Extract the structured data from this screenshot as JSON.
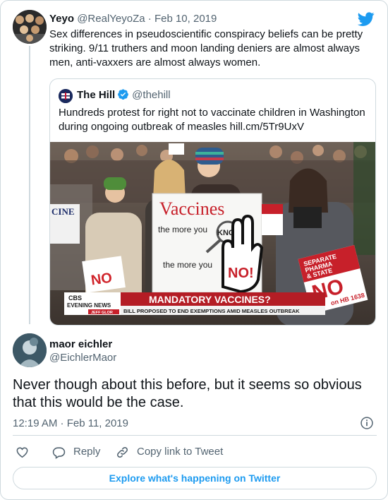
{
  "parent_tweet": {
    "author_name": "Yeyo",
    "author_handle": "@RealYeyoZa",
    "separator": " · ",
    "date": "Feb 10, 2019",
    "text": "Sex differences in pseudoscientific conspiracy beliefs can be pretty striking. 9/11 truthers and moon landing deniers are almost always men, anti-vaxxers are almost always women."
  },
  "quoted_tweet": {
    "author_name": "The Hill",
    "author_handle": "@thehill",
    "text": "Hundreds protest for right not to vaccinate children in Washington during ongoing outbreak of measles hill.cm/5Tr9UxV",
    "media": {
      "main_sign_title": "Vaccines",
      "main_sign_line1": "the more you",
      "main_sign_know": "KNOW",
      "main_sign_line2": "the more you",
      "main_sign_no": "NO!",
      "right_sign_line1": "SEPARATE",
      "right_sign_line2": "PHARMA",
      "right_sign_line3": "& STATE",
      "right_sign_no": "NO",
      "right_sign_bill": "on HB 1638",
      "small_sign_no": "NO",
      "left_sign_text": "CINE",
      "chyron_network_line1": "CBS",
      "chyron_network_line2": "EVENING NEWS",
      "chyron_anchor": "JEFF GLOR",
      "chyron_headline": "MANDATORY VACCINES?",
      "chyron_subhead": "BILL PROPOSED TO END EXEMPTIONS AMID MEASLES OUTBREAK"
    }
  },
  "reply_tweet": {
    "author_name": "maor eichler",
    "author_handle": "@EichlerMaor",
    "text": "Never though about this before, but it seems so obvious that this would be the case.",
    "timestamp": "12:19 AM · Feb 11, 2019"
  },
  "actions": {
    "like_icon": "heart-icon",
    "reply_label": "Reply",
    "copy_link_label": "Copy link to Tweet"
  },
  "explore_label": "Explore what's happening on Twitter",
  "colors": {
    "twitter_blue": "#1d9bf0",
    "text_primary": "#0f1419",
    "text_secondary": "#536471",
    "border": "#cfd9de"
  }
}
